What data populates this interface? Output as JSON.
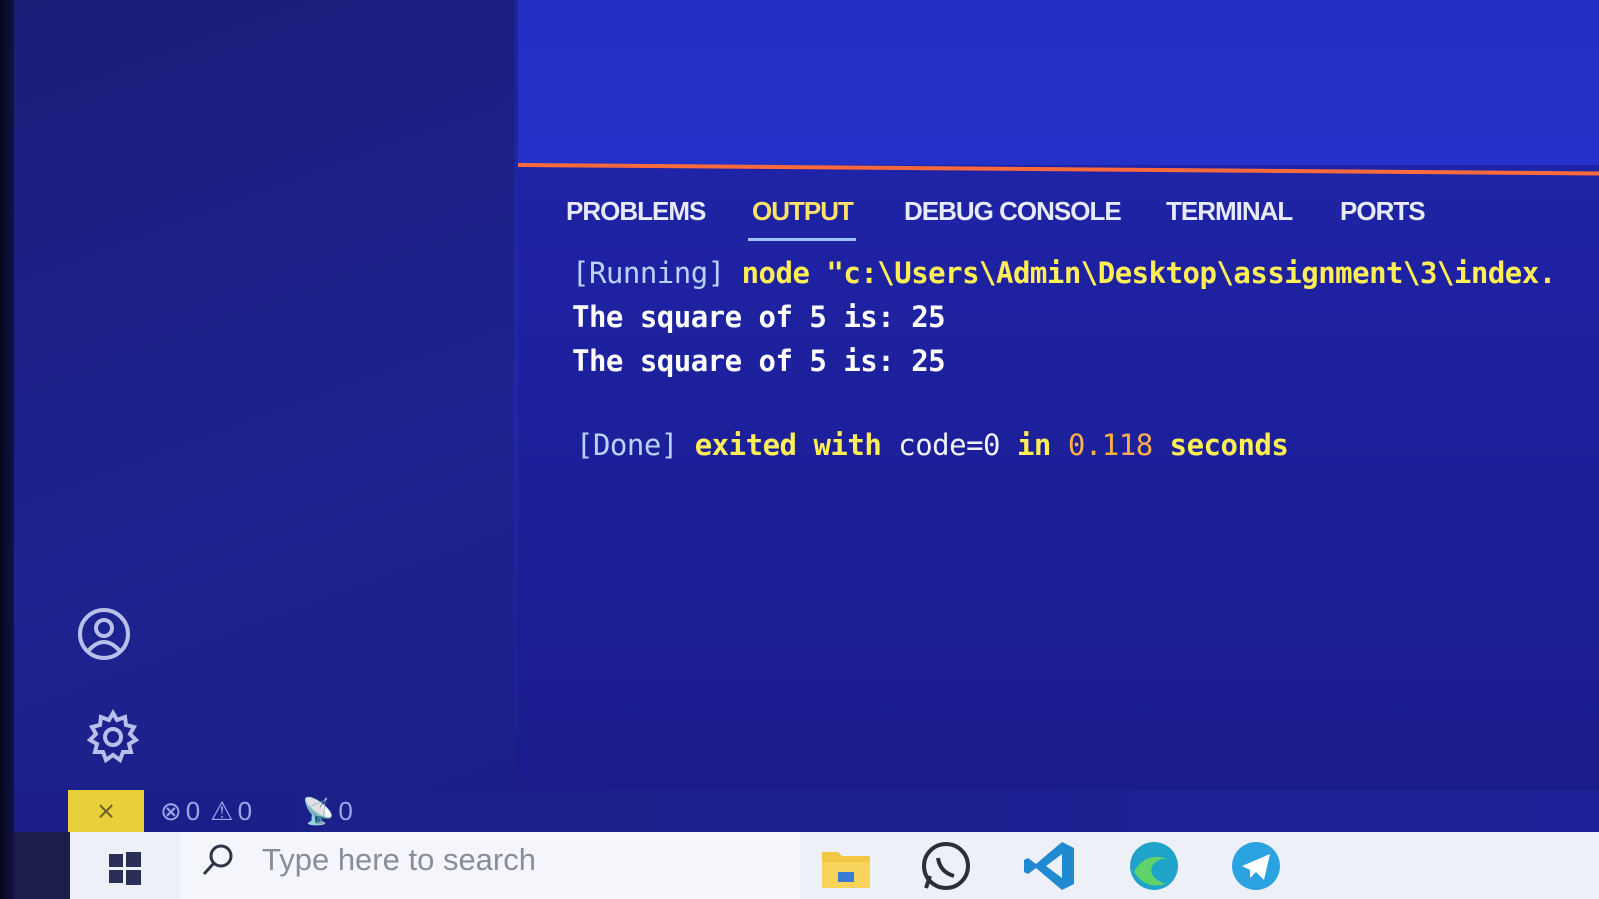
{
  "panel": {
    "tabs": [
      {
        "label": "PROBLEMS",
        "active": false
      },
      {
        "label": "OUTPUT",
        "active": true
      },
      {
        "label": "DEBUG CONSOLE",
        "active": false
      },
      {
        "label": "TERMINAL",
        "active": false
      },
      {
        "label": "PORTS",
        "active": false
      }
    ],
    "output": {
      "running_tag": "[Running]",
      "running_cmd": " node \"c:\\Users\\Admin\\Desktop\\assignment\\3\\index.",
      "lines": [
        "The square of 5 is: 25",
        "The square of 5 is: 25"
      ],
      "done_tag": "[Done]",
      "done_mid": " exited with ",
      "done_code": "code=0",
      "done_in": " in ",
      "done_time": "0.118",
      "done_unit": " seconds"
    }
  },
  "status_bar": {
    "errors": "0",
    "warnings": "0",
    "ports": "0"
  },
  "taskbar": {
    "search_placeholder": "Type here to search",
    "apps": [
      "file-explorer-icon",
      "whatsapp-icon",
      "vscode-icon",
      "edge-icon",
      "telegram-icon"
    ]
  },
  "colors": {
    "accent_border": "#ff6a3c",
    "remote_button": "#e8cf3c",
    "active_tab": "#ffe26a"
  }
}
